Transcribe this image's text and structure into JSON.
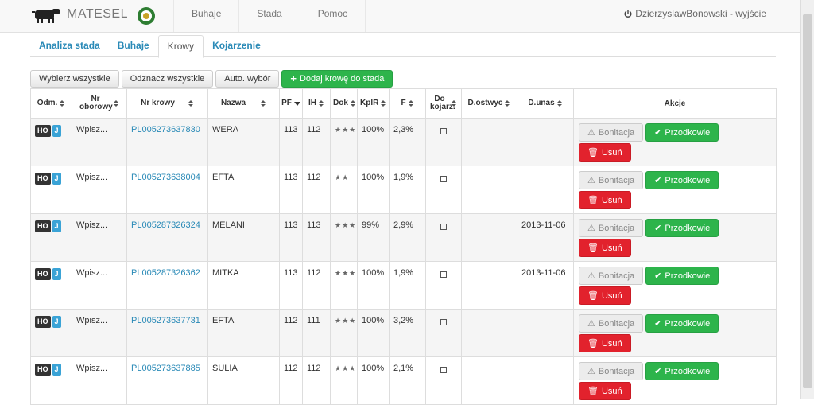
{
  "navbar": {
    "brand": "MATESEL",
    "links": [
      "Buhaje",
      "Stada",
      "Pomoc"
    ],
    "user_text": "DzierzyslawBonowski - wyjście"
  },
  "tabs": [
    {
      "label": "Analiza stada",
      "active": false
    },
    {
      "label": "Buhaje",
      "active": false
    },
    {
      "label": "Krowy",
      "active": true
    },
    {
      "label": "Kojarzenie",
      "active": false
    }
  ],
  "toolbar": {
    "select_all": "Wybierz wszystkie",
    "deselect_all": "Odznacz wszystkie",
    "auto_select": "Auto. wybór",
    "add_cow": "Dodaj krowę do stada"
  },
  "table": {
    "headers": {
      "odm": "Odm.",
      "nr_oborowy": "Nr oborowy",
      "nr_krowy": "Nr krowy",
      "nazwa": "Nazwa",
      "pf": "PF",
      "ih": "IH",
      "dok": "Dok",
      "kplr": "KplR",
      "f": "F",
      "do_kojarz": "Do kojarz.",
      "d_ostwyc": "D.ostwyc",
      "d_unas": "D.unas",
      "akcje": "Akcje"
    },
    "badge_ho": "HO",
    "badge_j": "J",
    "action_labels": {
      "bonitacja": "Bonitacja",
      "przodkowie": "Przodkowie",
      "usun": "Usuń"
    },
    "rows": [
      {
        "nr_oborowy": "Wpisz...",
        "nr_krowy": "PL005273637830",
        "nazwa": "WERA",
        "pf": "113",
        "ih": "112",
        "dok": "★★★",
        "kplr": "100%",
        "f": "2,3%",
        "d_ostwyc": "",
        "d_unas": ""
      },
      {
        "nr_oborowy": "Wpisz...",
        "nr_krowy": "PL005273638004",
        "nazwa": "EFTA",
        "pf": "113",
        "ih": "112",
        "dok": "★★",
        "kplr": "100%",
        "f": "1,9%",
        "d_ostwyc": "",
        "d_unas": ""
      },
      {
        "nr_oborowy": "Wpisz...",
        "nr_krowy": "PL005287326324",
        "nazwa": "MELANI",
        "pf": "113",
        "ih": "113",
        "dok": "★★★",
        "kplr": "99%",
        "f": "2,9%",
        "d_ostwyc": "",
        "d_unas": "2013-11-06"
      },
      {
        "nr_oborowy": "Wpisz...",
        "nr_krowy": "PL005287326362",
        "nazwa": "MITKA",
        "pf": "113",
        "ih": "112",
        "dok": "★★★",
        "kplr": "100%",
        "f": "1,9%",
        "d_ostwyc": "",
        "d_unas": "2013-11-06"
      },
      {
        "nr_oborowy": "Wpisz...",
        "nr_krowy": "PL005273637731",
        "nazwa": "EFTA",
        "pf": "112",
        "ih": "111",
        "dok": "★★★",
        "kplr": "100%",
        "f": "3,2%",
        "d_ostwyc": "",
        "d_unas": ""
      },
      {
        "nr_oborowy": "Wpisz...",
        "nr_krowy": "PL005273637885",
        "nazwa": "SULIA",
        "pf": "112",
        "ih": "112",
        "dok": "★★★",
        "kplr": "100%",
        "f": "2,1%",
        "d_ostwyc": "",
        "d_unas": ""
      }
    ]
  },
  "colors": {
    "accent": "#2a8ab7",
    "green": "#2db44b",
    "red": "#e2222d"
  }
}
